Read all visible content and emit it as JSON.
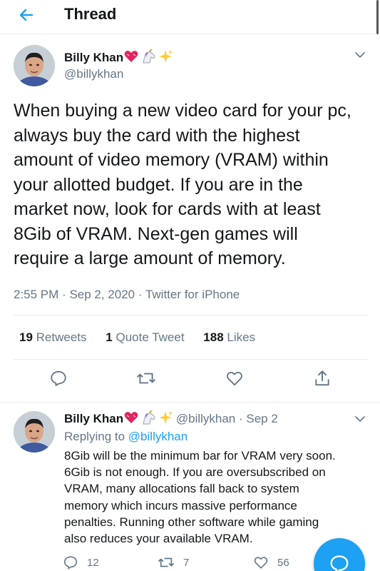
{
  "header": {
    "title": "Thread",
    "back_icon": "arrow-left-icon"
  },
  "main_tweet": {
    "author_name": "Billy Khan",
    "author_emoji": [
      "heart-emoji",
      "unicorn-emoji",
      "sparkles-emoji"
    ],
    "handle": "@billykhan",
    "text": "When buying a new video card for your pc,\nalways buy the card with the highest\namount of video memory (VRAM) within\nyour allotted budget.  If you are in the\nmarket now, look for cards with at least\n8Gib of VRAM. Next-gen games will\nrequire a large amount of memory.",
    "time": "2:55 PM",
    "date": "Sep 2, 2020",
    "source": "Twitter for iPhone",
    "retweets_count": "19",
    "retweets_label": "Retweets",
    "quote_count": "1",
    "quote_label": "Quote Tweet",
    "likes_count": "188",
    "likes_label": "Likes"
  },
  "reply_tweet": {
    "author_name": "Billy Khan",
    "handle": "@billykhan",
    "date": "Sep 2",
    "replying_prefix": "Replying to",
    "replying_to": "@billykhan",
    "text": "8Gib will be the minimum bar for VRAM very soon.\n6Gib is not enough.  If you are oversubscribed on\nVRAM, many allocations fall back to system\nmemory which incurs massive performance\npenalties.  Running other software while gaming\nalso reduces your available VRAM.",
    "reply_count": "12",
    "retweet_count": "7",
    "like_count": "56"
  },
  "colors": {
    "accent": "#1da1f2",
    "heart": "#e0245e",
    "text": "#14171a",
    "secondary_text": "#657786",
    "divider": "#e6ecf0"
  }
}
